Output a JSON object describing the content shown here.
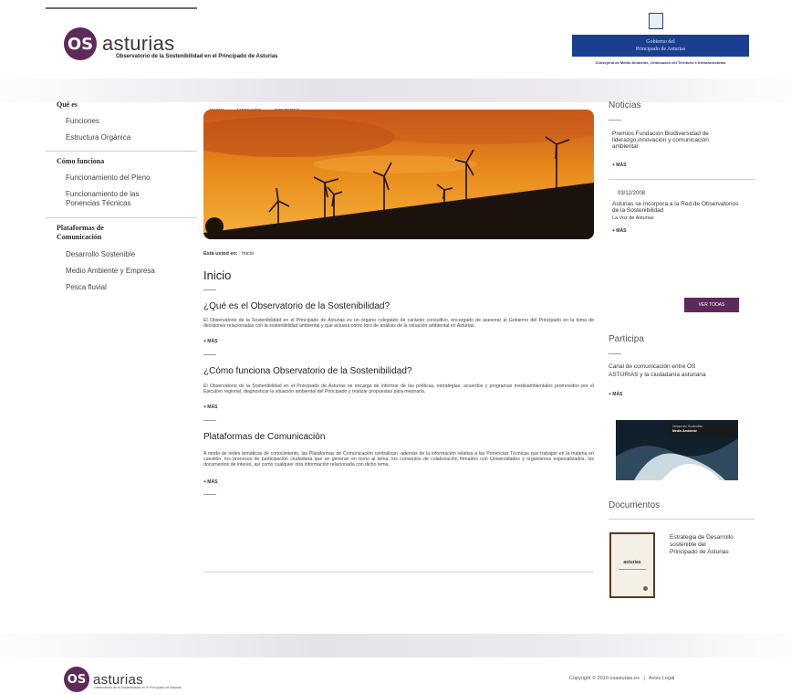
{
  "header": {
    "logo_mark": "OS",
    "logo_word": "asturias",
    "logo_subtitle": "Observatorio de la Sostenibilidad en el Principado de Asturias",
    "gov_line1": "Gobierno del",
    "gov_line2": "Principado de Asturias",
    "gov_dept": "Consejería de Medio Ambiente, Ordenación del Territorio e Infraestructuras"
  },
  "sidebar": {
    "sections": [
      {
        "title": "Qué es",
        "items": [
          "Funciones",
          "Estructura Orgánica"
        ]
      },
      {
        "title": "Cómo funciona",
        "items": [
          "Funcionamiento del Pleno",
          "Funcionamiento de las Ponencias Técnicas"
        ]
      },
      {
        "title": "Plataformas de Comunicación",
        "items": [
          "Desarrollo Sostenible",
          "Medio Ambiente y Empresa",
          "Pesca fluvial"
        ]
      }
    ]
  },
  "tabs": [
    "INICIO",
    "MAPA WEB",
    "CONTACTO"
  ],
  "breadcrumb": {
    "label": "Está usted en:",
    "current": "Inicio"
  },
  "main": {
    "page_title": "Inicio",
    "sections": [
      {
        "title": "¿Qué es el Observatorio de la Sostenibilidad?",
        "text": "El Observatorio de la Sostenibilidad en el Principado de Asturias es un órgano colegiado de carácter consultivo, encargado de asesorar al Gobierno del Principado en la toma de decisiones relacionadas con la sostenibilidad ambiental y que actuará como foro de análisis de la situación ambiental en Asturias.",
        "more": "+ MÁS"
      },
      {
        "title": "¿Cómo funciona Observatorio de la Sostenibilidad?",
        "text": "El Observatorio de la Sostenibilidad en el Principado de Asturias se encarga de informar de las políticas, estrategias, acuerdos y programas medioambientales promovidos por el Ejecutivo regional, diagnosticar la situación ambiental del Principado y realizar propuestas para mejorarla.",
        "more": "+ MÁS"
      },
      {
        "title": "Plataformas de Comunicación",
        "text": "A modo de redes temáticas de conocimiento, las Plataformas de Comunicación centralizan -además de la información relativa a las Ponencias Técnicas que trabajan en la materia en cuestión, los procesos de participación ciudadana que se generan en torno al tema, los convenios de colaboración firmados con Universidades y organismos especializados, los documentos de interés, así como cualquier otra información relacionada con dicho tema.",
        "more": "+ MÁS"
      }
    ]
  },
  "news": {
    "title": "Noticias",
    "items": [
      {
        "date": "",
        "text": "Premios Fundación Biodiversidad de liderazgo,innovación y comunicación ambiental",
        "source": "",
        "more": "+ MÁS"
      },
      {
        "date": "03/12/2008",
        "text": "Asturias se incorpora a la Red de Observatorios de la Sostenibilidad",
        "source": "La Voz de Asturias",
        "more": "+ MÁS"
      }
    ],
    "view_all": "VER TODAS"
  },
  "participa": {
    "title": "Participa",
    "text": "Canal de comunicación entre OS ASTURIAS y la ciudadanía asturiana",
    "more": "+ MÁS",
    "image_caption_line1": "Desarrollo Sostenible",
    "image_caption_line2": "Medio Ambiente"
  },
  "documentos": {
    "title": "Documentos",
    "doc_title": "Estrategia de Desarrollo sostenible del Principado de Asturias",
    "cover_word": "asturias"
  },
  "footer": {
    "logo_mark": "OS",
    "logo_word": "asturias",
    "logo_subtitle": "Observatorio de la Sostenibilidad en el Principado de Asturias",
    "copyright": "Copyright © 2010 osasturias.es",
    "separator": "|",
    "legal": "Aviso Legal"
  },
  "colors": {
    "brand": "#5e2a5a",
    "gov_blue": "#1b3f8f",
    "sky_orange": "#e8891a"
  }
}
